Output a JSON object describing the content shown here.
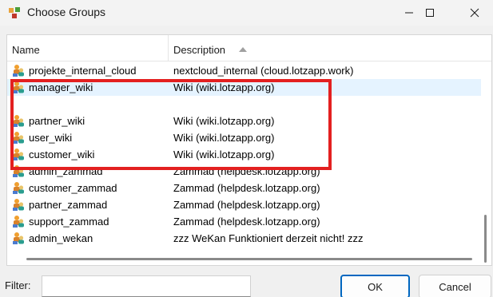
{
  "window": {
    "title": "Choose Groups"
  },
  "list": {
    "columns": {
      "name": "Name",
      "description": "Description"
    },
    "rows": [
      {
        "name": "projekte_internal_cloud",
        "description": "nextcloud_internal (cloud.lotzapp.work)"
      },
      {
        "name": "manager_wiki",
        "description": "Wiki (wiki.lotzapp.org)"
      },
      {
        "name": "",
        "description": ""
      },
      {
        "name": "partner_wiki",
        "description": "Wiki (wiki.lotzapp.org)"
      },
      {
        "name": "user_wiki",
        "description": "Wiki (wiki.lotzapp.org)"
      },
      {
        "name": "customer_wiki",
        "description": "Wiki (wiki.lotzapp.org)"
      },
      {
        "name": "admin_zammad",
        "description": "Zammad (helpdesk.lotzapp.org)"
      },
      {
        "name": "customer_zammad",
        "description": "Zammad (helpdesk.lotzapp.org)"
      },
      {
        "name": "partner_zammad",
        "description": "Zammad (helpdesk.lotzapp.org)"
      },
      {
        "name": "support_zammad",
        "description": "Zammad (helpdesk.lotzapp.org)"
      },
      {
        "name": "admin_wekan",
        "description": "zzz WeKan Funktioniert derzeit nicht! zzz"
      }
    ]
  },
  "filter": {
    "label": "Filter:",
    "value": ""
  },
  "buttons": {
    "ok": "OK",
    "cancel": "Cancel"
  },
  "colors": {
    "highlight": "#e32020",
    "selected_row": "#e5f3ff",
    "accent": "#0067c0"
  }
}
